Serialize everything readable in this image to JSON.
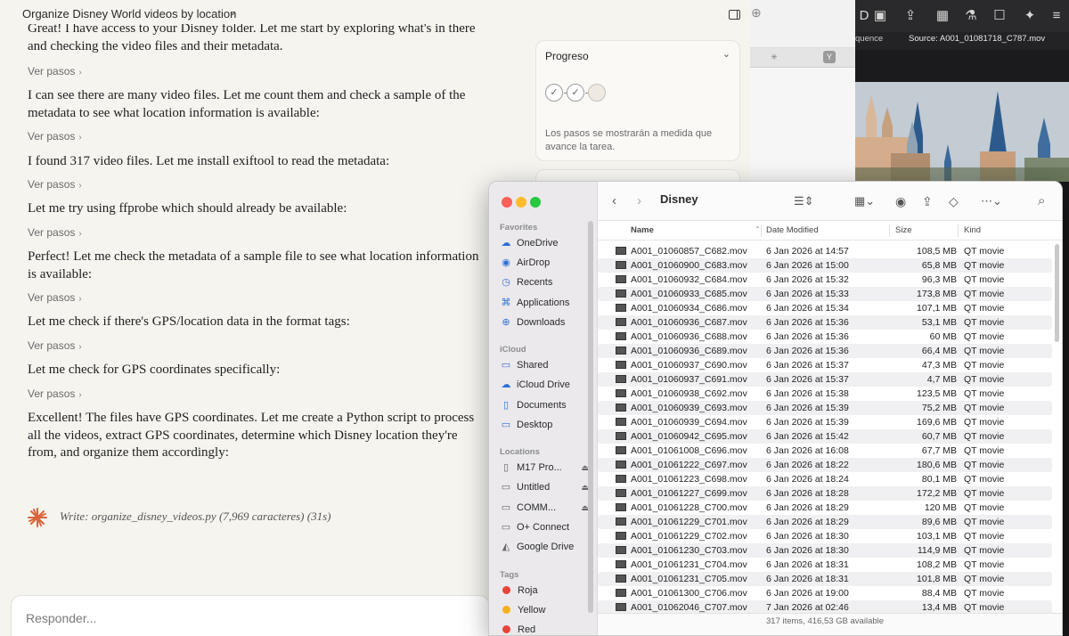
{
  "chat": {
    "title": "Organize Disney World videos by location",
    "messages": [
      "Great! I have access to your Disney folder. Let me start by exploring what's in there and checking the video files and their metadata.",
      "I can see there are many video files. Let me count them and check a sample of the metadata to see what location information is available:",
      "I found 317 video files. Let me install exiftool to read the metadata:",
      "Let me try using ffprobe which should already be available:",
      "Perfect! Let me check the metadata of a sample file to see what location information is available:",
      "Let me check if there's GPS/location data in the format tags:",
      "Let me check for GPS coordinates specifically:",
      "Excellent! The files have GPS coordinates. Let me create a Python script to process all the videos, extract GPS coordinates, determine which Disney location they're from, and organize them accordingly:"
    ],
    "steps_label": "Ver pasos",
    "write_action": "Write: organize_disney_videos.py (7,969 caracteres)",
    "write_time": "(31s)",
    "composer_placeholder": "Responder...",
    "accent_color": "#d9653b"
  },
  "progress": {
    "title": "Progreso",
    "note": "Los pasos se mostrarán a medida que avance la tarea.",
    "steps": [
      "done",
      "done",
      "pending"
    ]
  },
  "video_app": {
    "sequence_label": "quence",
    "source_label": "Source: A001_01081718_C787.mov"
  },
  "finder": {
    "title": "Disney",
    "sidebar": {
      "favorites_label": "Favorites",
      "favorites": [
        {
          "label": "OneDrive",
          "icon": "cloud-icon"
        },
        {
          "label": "AirDrop",
          "icon": "airdrop-icon"
        },
        {
          "label": "Recents",
          "icon": "clock-icon"
        },
        {
          "label": "Applications",
          "icon": "applications-icon"
        },
        {
          "label": "Downloads",
          "icon": "download-icon"
        }
      ],
      "icloud_label": "iCloud",
      "icloud": [
        {
          "label": "Shared",
          "icon": "shared-folder-icon"
        },
        {
          "label": "iCloud Drive",
          "icon": "cloud-icon"
        },
        {
          "label": "Documents",
          "icon": "document-icon"
        },
        {
          "label": "Desktop",
          "icon": "desktop-icon"
        }
      ],
      "locations_label": "Locations",
      "locations": [
        {
          "label": "M17 Pro...",
          "icon": "drive-icon",
          "eject": true
        },
        {
          "label": "Untitled",
          "icon": "drive-icon",
          "eject": true
        },
        {
          "label": "COMM...",
          "icon": "drive-icon",
          "eject": true
        },
        {
          "label": "O+ Connect",
          "icon": "drive-icon",
          "eject": false
        },
        {
          "label": "Google Drive",
          "icon": "google-drive-icon",
          "eject": false
        }
      ],
      "tags_label": "Tags",
      "tags": [
        {
          "label": "Roja",
          "color": "#e5443a"
        },
        {
          "label": "Yellow",
          "color": "#f2b21f"
        },
        {
          "label": "Red",
          "color": "#e5443a"
        }
      ]
    },
    "columns": {
      "name": "Name",
      "date": "Date Modified",
      "size": "Size",
      "kind": "Kind"
    },
    "files": [
      {
        "name": "A001_01060857_C682.mov",
        "date": "6 Jan 2026 at 14:57",
        "size": "108,5 MB",
        "kind": "QT movie"
      },
      {
        "name": "A001_01060900_C683.mov",
        "date": "6 Jan 2026 at 15:00",
        "size": "65,8 MB",
        "kind": "QT movie"
      },
      {
        "name": "A001_01060932_C684.mov",
        "date": "6 Jan 2026 at 15:32",
        "size": "96,3 MB",
        "kind": "QT movie"
      },
      {
        "name": "A001_01060933_C685.mov",
        "date": "6 Jan 2026 at 15:33",
        "size": "173,8 MB",
        "kind": "QT movie"
      },
      {
        "name": "A001_01060934_C686.mov",
        "date": "6 Jan 2026 at 15:34",
        "size": "107,1 MB",
        "kind": "QT movie"
      },
      {
        "name": "A001_01060936_C687.mov",
        "date": "6 Jan 2026 at 15:36",
        "size": "53,1 MB",
        "kind": "QT movie"
      },
      {
        "name": "A001_01060936_C688.mov",
        "date": "6 Jan 2026 at 15:36",
        "size": "60 MB",
        "kind": "QT movie"
      },
      {
        "name": "A001_01060936_C689.mov",
        "date": "6 Jan 2026 at 15:36",
        "size": "66,4 MB",
        "kind": "QT movie"
      },
      {
        "name": "A001_01060937_C690.mov",
        "date": "6 Jan 2026 at 15:37",
        "size": "47,3 MB",
        "kind": "QT movie"
      },
      {
        "name": "A001_01060937_C691.mov",
        "date": "6 Jan 2026 at 15:37",
        "size": "4,7 MB",
        "kind": "QT movie"
      },
      {
        "name": "A001_01060938_C692.mov",
        "date": "6 Jan 2026 at 15:38",
        "size": "123,5 MB",
        "kind": "QT movie"
      },
      {
        "name": "A001_01060939_C693.mov",
        "date": "6 Jan 2026 at 15:39",
        "size": "75,2 MB",
        "kind": "QT movie"
      },
      {
        "name": "A001_01060939_C694.mov",
        "date": "6 Jan 2026 at 15:39",
        "size": "169,6 MB",
        "kind": "QT movie"
      },
      {
        "name": "A001_01060942_C695.mov",
        "date": "6 Jan 2026 at 15:42",
        "size": "60,7 MB",
        "kind": "QT movie"
      },
      {
        "name": "A001_01061008_C696.mov",
        "date": "6 Jan 2026 at 16:08",
        "size": "67,7 MB",
        "kind": "QT movie"
      },
      {
        "name": "A001_01061222_C697.mov",
        "date": "6 Jan 2026 at 18:22",
        "size": "180,6 MB",
        "kind": "QT movie"
      },
      {
        "name": "A001_01061223_C698.mov",
        "date": "6 Jan 2026 at 18:24",
        "size": "80,1 MB",
        "kind": "QT movie"
      },
      {
        "name": "A001_01061227_C699.mov",
        "date": "6 Jan 2026 at 18:28",
        "size": "172,2 MB",
        "kind": "QT movie"
      },
      {
        "name": "A001_01061228_C700.mov",
        "date": "6 Jan 2026 at 18:29",
        "size": "120 MB",
        "kind": "QT movie"
      },
      {
        "name": "A001_01061229_C701.mov",
        "date": "6 Jan 2026 at 18:29",
        "size": "89,6 MB",
        "kind": "QT movie"
      },
      {
        "name": "A001_01061229_C702.mov",
        "date": "6 Jan 2026 at 18:30",
        "size": "103,1 MB",
        "kind": "QT movie"
      },
      {
        "name": "A001_01061230_C703.mov",
        "date": "6 Jan 2026 at 18:30",
        "size": "114,9 MB",
        "kind": "QT movie"
      },
      {
        "name": "A001_01061231_C704.mov",
        "date": "6 Jan 2026 at 18:31",
        "size": "108,2 MB",
        "kind": "QT movie"
      },
      {
        "name": "A001_01061231_C705.mov",
        "date": "6 Jan 2026 at 18:31",
        "size": "101,8 MB",
        "kind": "QT movie"
      },
      {
        "name": "A001_01061300_C706.mov",
        "date": "6 Jan 2026 at 19:00",
        "size": "88,4 MB",
        "kind": "QT movie"
      },
      {
        "name": "A001_01062046_C707.mov",
        "date": "7 Jan 2026 at 02:46",
        "size": "13,4 MB",
        "kind": "QT movie"
      }
    ],
    "status": "317 items, 416,53 GB available"
  }
}
